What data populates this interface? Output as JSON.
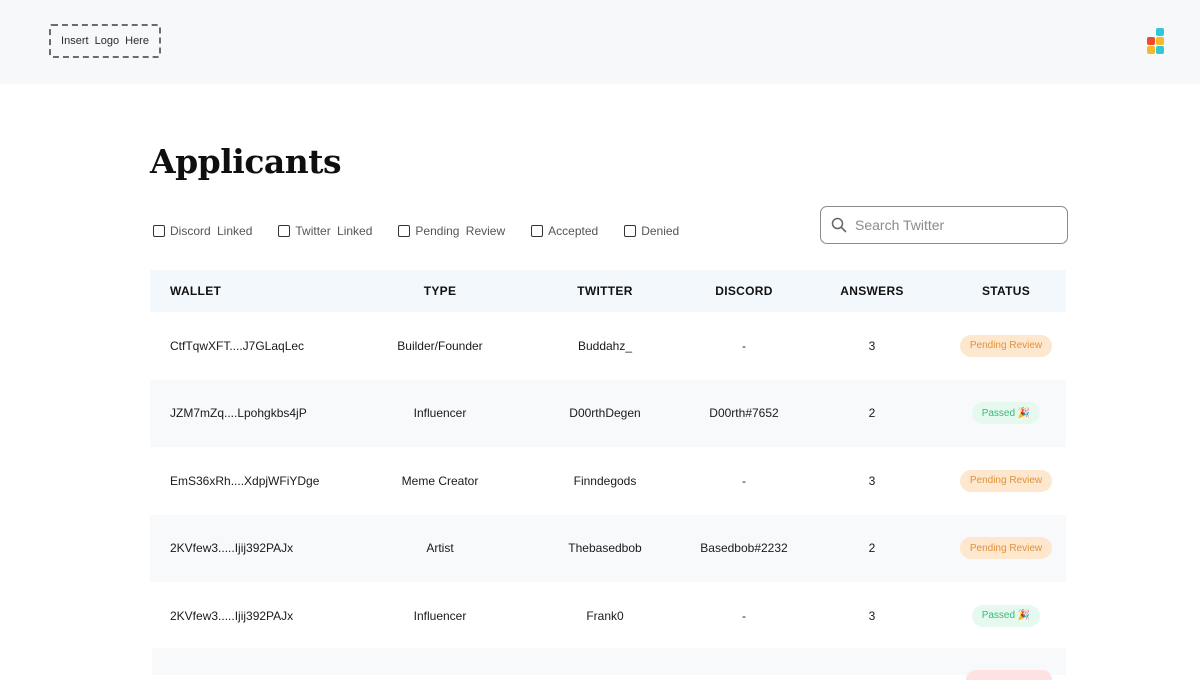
{
  "header": {
    "logo_placeholder": "Insert Logo Here",
    "app_icon_colors": [
      "#33c7d6",
      "#f04a2e",
      "#f7b92b",
      "#33c7d6",
      "#f7b92b",
      "#33c7d6"
    ]
  },
  "page": {
    "title": "Applicants"
  },
  "filters": [
    {
      "label": "Discord Linked",
      "checked": false
    },
    {
      "label": "Twitter Linked",
      "checked": false
    },
    {
      "label": "Pending Review",
      "checked": false
    },
    {
      "label": "Accepted",
      "checked": false
    },
    {
      "label": "Denied",
      "checked": false
    }
  ],
  "search": {
    "placeholder": "Search Twitter",
    "value": ""
  },
  "table": {
    "columns": [
      "WALLET",
      "TYPE",
      "TWITTER",
      "DISCORD",
      "ANSWERS",
      "STATUS"
    ],
    "rows": [
      {
        "wallet": "CtfTqwXFT....J7GLaqLec",
        "type": "Builder/Founder",
        "twitter": "Buddahz_",
        "discord": "-",
        "answers": "3",
        "status": "Pending Review"
      },
      {
        "wallet": "JZM7mZq....Lpohgkbs4jP",
        "type": "Influencer",
        "twitter": "D00rthDegen",
        "discord": "D00rth#7652",
        "answers": "2",
        "status": "Passed 🎉"
      },
      {
        "wallet": "EmS36xRh....XdpjWFiYDge",
        "type": "Meme Creator",
        "twitter": "Finndegods",
        "discord": "-",
        "answers": "3",
        "status": "Pending Review"
      },
      {
        "wallet": "2KVfew3.....Ijij392PAJx",
        "type": "Artist",
        "twitter": "Thebasedbob",
        "discord": "Basedbob#2232",
        "answers": "2",
        "status": "Pending Review"
      },
      {
        "wallet": "2KVfew3.....Ijij392PAJx",
        "type": "Influencer",
        "twitter": "Frank0",
        "discord": "-",
        "answers": "3",
        "status": "Passed 🎉"
      }
    ]
  },
  "colors": {
    "pending_bg": "#fde7cf",
    "pending_text": "#e2923a",
    "passed_bg": "#e6f9ef",
    "passed_text": "#3cb878",
    "denied_bg": "#fde1e3",
    "header_bg": "#f7f8fa",
    "table_header_bg": "#f3f8fc"
  },
  "icons": {
    "search": "search-icon",
    "app": "app-grid-icon"
  }
}
